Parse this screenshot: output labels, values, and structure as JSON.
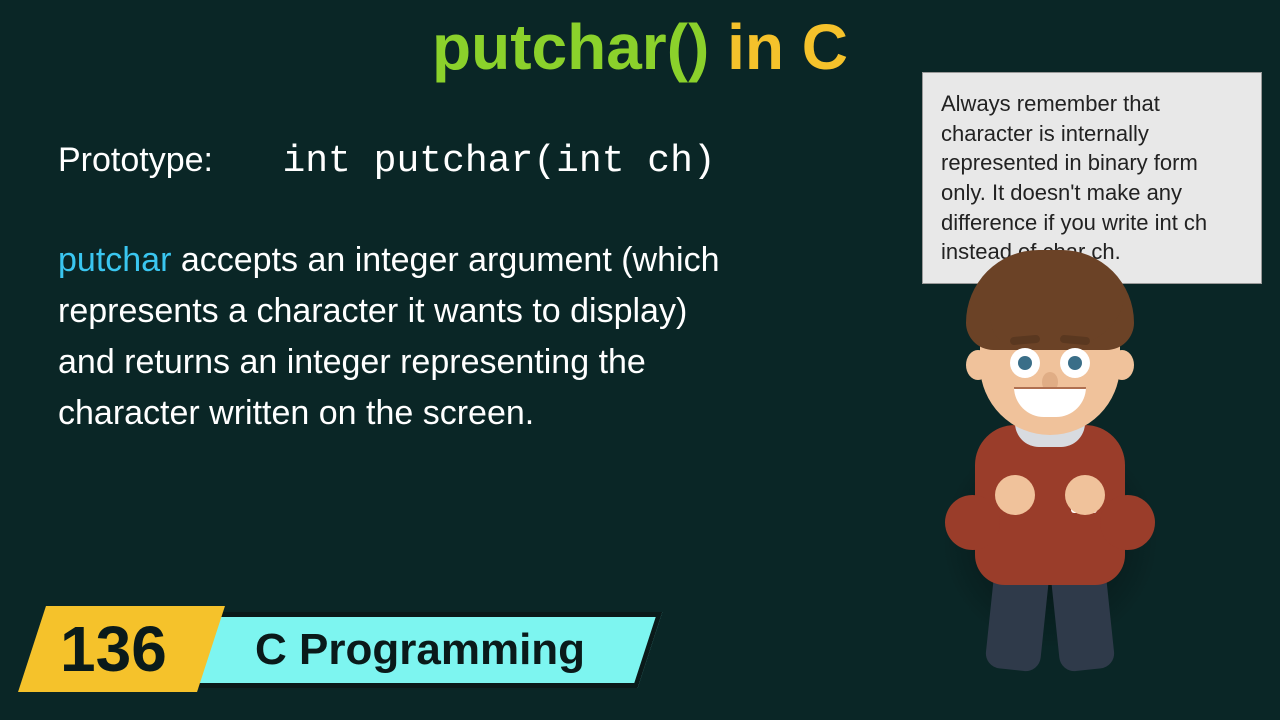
{
  "title": {
    "part1": "putchar()",
    "part2": " in C"
  },
  "prototype": {
    "label": "Prototype:",
    "code": "int putchar(int ch)"
  },
  "description": {
    "keyword": "putchar",
    "rest": " accepts an integer argument (which represents a character it wants to display) and returns an integer representing the character written on the screen."
  },
  "speech": "Always remember that character is internally represented in binary form only. It doesn't make any difference if you write int ch instead of char ch.",
  "banner": {
    "number": "136",
    "label": "C Programming"
  }
}
